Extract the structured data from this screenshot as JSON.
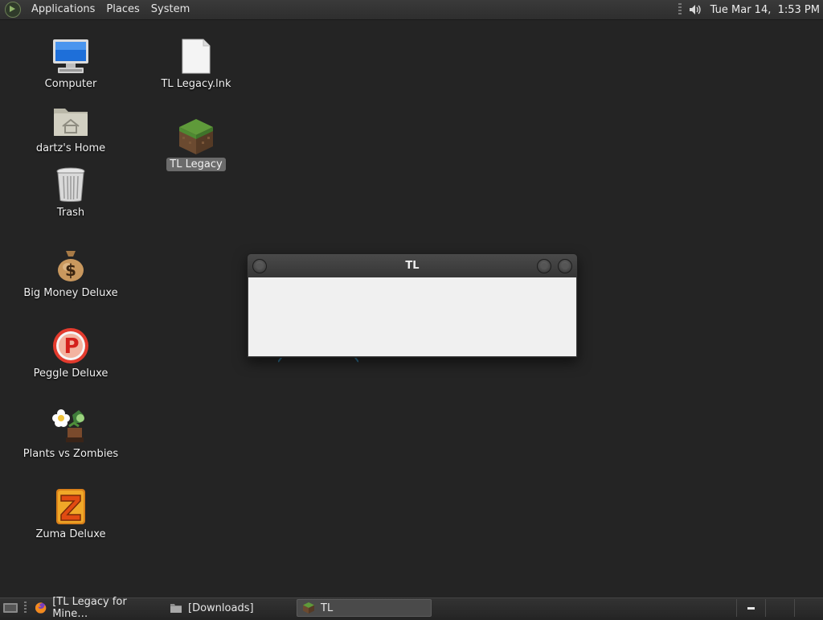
{
  "top_panel": {
    "menus": [
      "Applications",
      "Places",
      "System"
    ],
    "clock": "Tue Mar 14,  1:53 PM",
    "icons": [
      "distro-logo-icon",
      "volume-icon"
    ]
  },
  "desktop": {
    "icons": [
      {
        "label": "Computer",
        "icon": "computer-icon"
      },
      {
        "label": "dartz's Home",
        "icon": "home-folder-icon"
      },
      {
        "label": "Trash",
        "icon": "trash-icon"
      },
      {
        "label": "Big Money Deluxe",
        "icon": "money-bag-icon"
      },
      {
        "label": "Peggle Deluxe",
        "icon": "peggle-icon"
      },
      {
        "label": "Plants vs Zombies",
        "icon": "plants-vs-zombies-icon"
      },
      {
        "label": "Zuma Deluxe",
        "icon": "zuma-icon"
      },
      {
        "label": "TL Legacy.lnk",
        "icon": "file-icon"
      },
      {
        "label": "TL Legacy",
        "icon": "grass-block-icon",
        "selected": true
      }
    ]
  },
  "window": {
    "title": "TL"
  },
  "taskbar": {
    "tasks": [
      {
        "label": "[TL Legacy for Mine…",
        "icon": "firefox-icon"
      },
      {
        "label": "[Downloads]",
        "icon": "folder-icon"
      },
      {
        "label": "TL",
        "icon": "grass-block-icon",
        "active": true
      }
    ]
  },
  "colors": {
    "desktop_bg": "#242424",
    "panel_bg": "#2e2e2e",
    "window_client": "#f0f0f0",
    "selection": "#6b6b6b"
  }
}
